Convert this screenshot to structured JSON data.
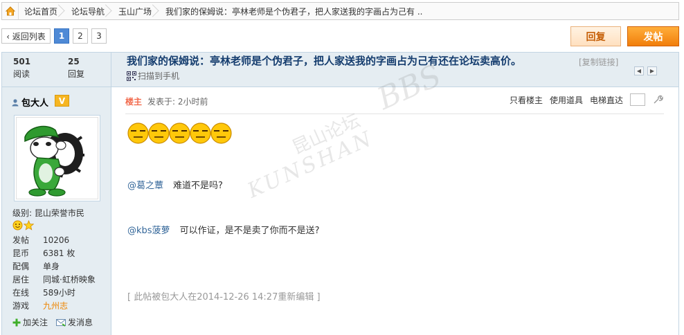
{
  "breadcrumb": {
    "items": [
      "论坛首页",
      "论坛导航",
      "玉山广场",
      "我们家的保姆说：亭林老师是个伪君子，把人家送我的字画占为己有 .."
    ]
  },
  "pager": {
    "back_label": "‹ 返回列表",
    "pages": [
      "1",
      "2",
      "3"
    ],
    "current": "1"
  },
  "buttons": {
    "reply": "回复",
    "post": "发帖"
  },
  "thread": {
    "views": "501",
    "views_label": "阅读",
    "replies": "25",
    "replies_label": "回复",
    "title": "我们家的保姆说：亭林老师是个伪君子，把人家送我的字画占为己有还在论坛卖高价。",
    "copy_link": "[复制链接]",
    "scan_label": "扫描到手机"
  },
  "author": {
    "name": "包大人",
    "badge": "V",
    "level": "级别: 昆山荣誉市民",
    "profile": [
      {
        "k": "发帖",
        "v": "10206"
      },
      {
        "k": "昆币",
        "v": "6381 枚"
      },
      {
        "k": "配偶",
        "v": "单身"
      },
      {
        "k": "居住",
        "v": "同城·虹桥映象"
      },
      {
        "k": "在线",
        "v": "589小时"
      },
      {
        "k": "游戏",
        "v": "九州志"
      }
    ],
    "follow": "加关注",
    "message": "发消息"
  },
  "post": {
    "op_label": "楼主",
    "posted": "发表于: 2小时前",
    "only_op": "只看楼主",
    "use_tool": "使用道具",
    "elevator": "电梯直达",
    "lines": [
      {
        "at": "@葛之蕈",
        "text": "难道不是吗?"
      },
      {
        "at": "@kbs菠萝",
        "text": "可以作证，是不是卖了你而不是送?"
      }
    ],
    "edited": "[ 此帖被包大人在2014-12-26 14:27重新编辑 ]"
  },
  "watermark": {
    "cn": "昆山论坛",
    "en": "KUNSHAN",
    "big": "BBS"
  },
  "colors": {
    "accent_blue": "#143c6e",
    "sidebar_bg": "#e5edf2",
    "post_button": "#f17e0b",
    "op_label": "#f26c4f",
    "link": "#336699"
  }
}
